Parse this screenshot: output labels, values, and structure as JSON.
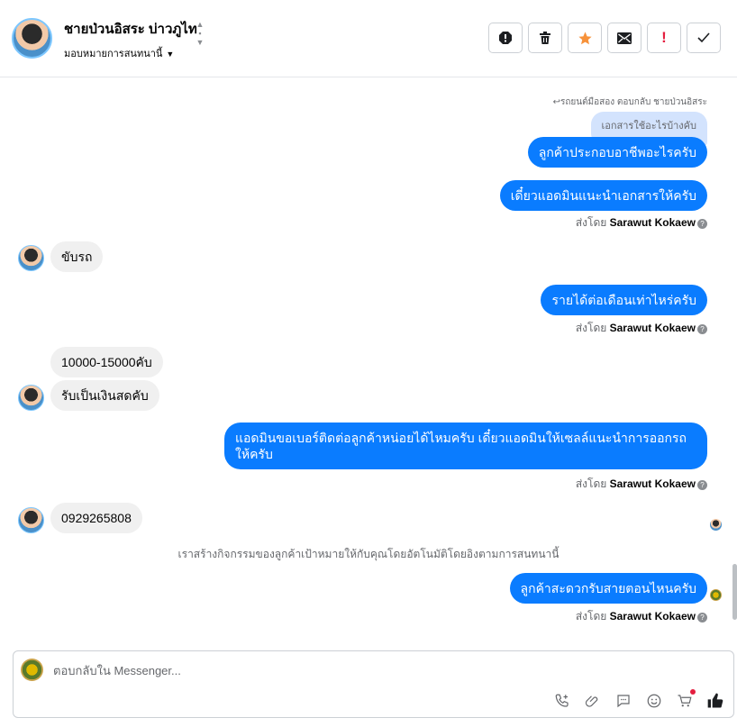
{
  "header": {
    "name": "ชายป่วนอิสระ บ่าวภูไท",
    "assign_label": "มอบหมายการสนทนานี้",
    "actions": [
      {
        "icon": "spam-icon"
      },
      {
        "icon": "trash-icon"
      },
      {
        "icon": "star-icon"
      },
      {
        "icon": "mail-icon"
      },
      {
        "icon": "exclamation-icon"
      },
      {
        "icon": "check-icon"
      }
    ]
  },
  "messages": {
    "reply_meta": "↩รถยนต์มือสอง ตอบกลับ ชายป่วนอิสระ",
    "quoted_text": "เอกสารใช้อะไรบ้างคับ",
    "out_1": "ลูกค้าประกอบอาชีพอะไรครับ",
    "out_2": "เดี๋ยวแอดมินแนะนำเอกสารให้ครับ",
    "sent_by_prefix": "ส่งโดย",
    "sent_by_name": "Sarawut Kokaew",
    "in_1": "ขับรถ",
    "out_3": "รายได้ต่อเดือนเท่าไหร่ครับ",
    "in_2": "10000-15000คับ",
    "in_3": "รับเป็นเงินสดคับ",
    "out_4": "แอดมินขอเบอร์ติดต่อลูกค้าหน่อยได้ไหมครับ เดี๋ยวแอดมินให้เซลล์แนะนำการออกรถให้ครับ",
    "in_4": "0929265808",
    "system_note": "เราสร้างกิจกรรมของลูกค้าเป้าหมายให้กับคุณโดยอัตโนมัติโดยอิงตามการสนทนานี้",
    "out_5": "ลูกค้าสะดวกรับสายตอนไหนครับ"
  },
  "composer": {
    "placeholder": "ตอบกลับใน Messenger...",
    "tools": [
      "phone-add-icon",
      "attachment-icon",
      "saved-reply-icon",
      "emoji-icon",
      "cart-icon",
      "like-icon"
    ]
  },
  "colors": {
    "outgoing_bubble": "#0a7cff",
    "incoming_bubble": "#f0f0f0",
    "star": "#f7923a",
    "exclamation": "#e41e3f"
  }
}
